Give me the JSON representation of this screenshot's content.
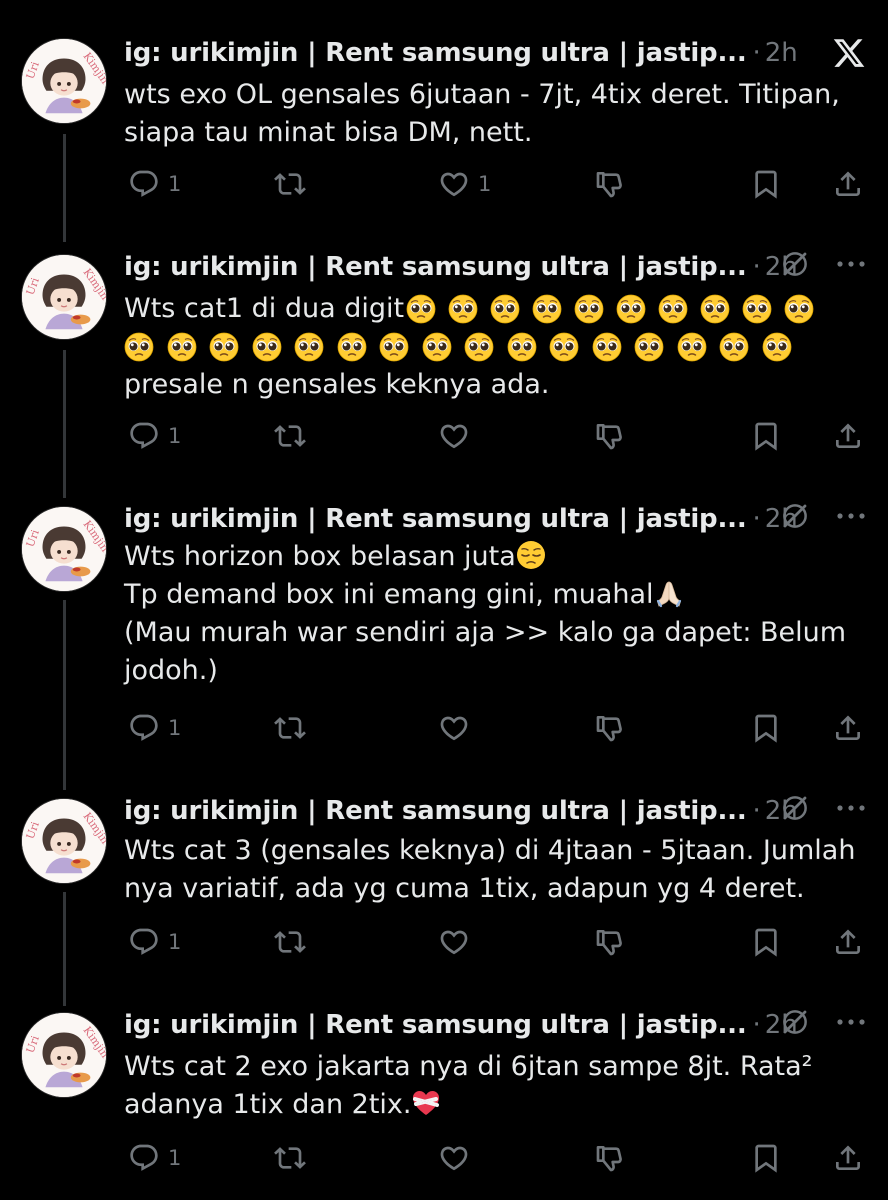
{
  "tweets": [
    {
      "author": "ig: urikimjin | Rent samsung ultra | jastip...",
      "separator": "·",
      "time": "2h",
      "text_lines": [
        "wts exo OL gensales 6jutaan - 7jt, 4tix deret. Titipan,",
        "siapa tau minat bisa DM, nett."
      ],
      "reply_count": "1",
      "like_count": "1"
    },
    {
      "author": "ig: urikimjin | Rent samsung ultra | jastip...",
      "separator": "·",
      "time": "2h",
      "text_line1": "Wts cat1 di dua digit",
      "text_line3": "presale n gensales keknya ada.",
      "reply_count": "1",
      "like_count": ""
    },
    {
      "author": "ig: urikimjin | Rent samsung ultra | jastip...",
      "separator": "·",
      "time": "2h",
      "text_line1": "Wts horizon box belasan juta",
      "text_line2": "Tp demand box ini emang gini, muahal",
      "text_line3": "(Mau murah war sendiri aja >> kalo ga dapet: Belum",
      "text_line4": "jodoh.)",
      "reply_count": "1",
      "like_count": ""
    },
    {
      "author": "ig: urikimjin | Rent samsung ultra | jastip...",
      "separator": "·",
      "time": "2h",
      "text_lines": [
        "Wts cat 3 (gensales keknya) di 4jtaan - 5jtaan. Jumlah",
        "nya variatif, ada yg cuma 1tix, adapun yg 4 deret."
      ],
      "reply_count": "1",
      "like_count": ""
    },
    {
      "author": "ig: urikimjin | Rent samsung ultra | jastip...",
      "separator": "·",
      "time": "2h",
      "text_line1": "Wts cat 2 exo jakarta nya di 6jtan sampe 8jt. Rata²",
      "text_line2": "adanya 1tix dan 2tix.",
      "reply_count": "1",
      "like_count": ""
    }
  ],
  "icons": {
    "top_right_first": "x-logo-icon",
    "top_right_others": [
      "grok-icon",
      "more-icon"
    ],
    "actions": [
      "reply-icon",
      "retweet-icon",
      "like-icon",
      "downvote-icon",
      "bookmark-icon",
      "share-icon"
    ],
    "emojis": [
      "pleading-face-emoji",
      "pensive-face-emoji",
      "folded-hands-emoji",
      "mending-heart-emoji"
    ]
  },
  "colors": {
    "background": "#000000",
    "text": "#e7e9ea",
    "muted": "#71767b",
    "thread_line": "#333639",
    "emoji_yellow": "#ffcc33"
  },
  "pleading_emoji_counts": {
    "line1": 10,
    "line2": 16
  }
}
